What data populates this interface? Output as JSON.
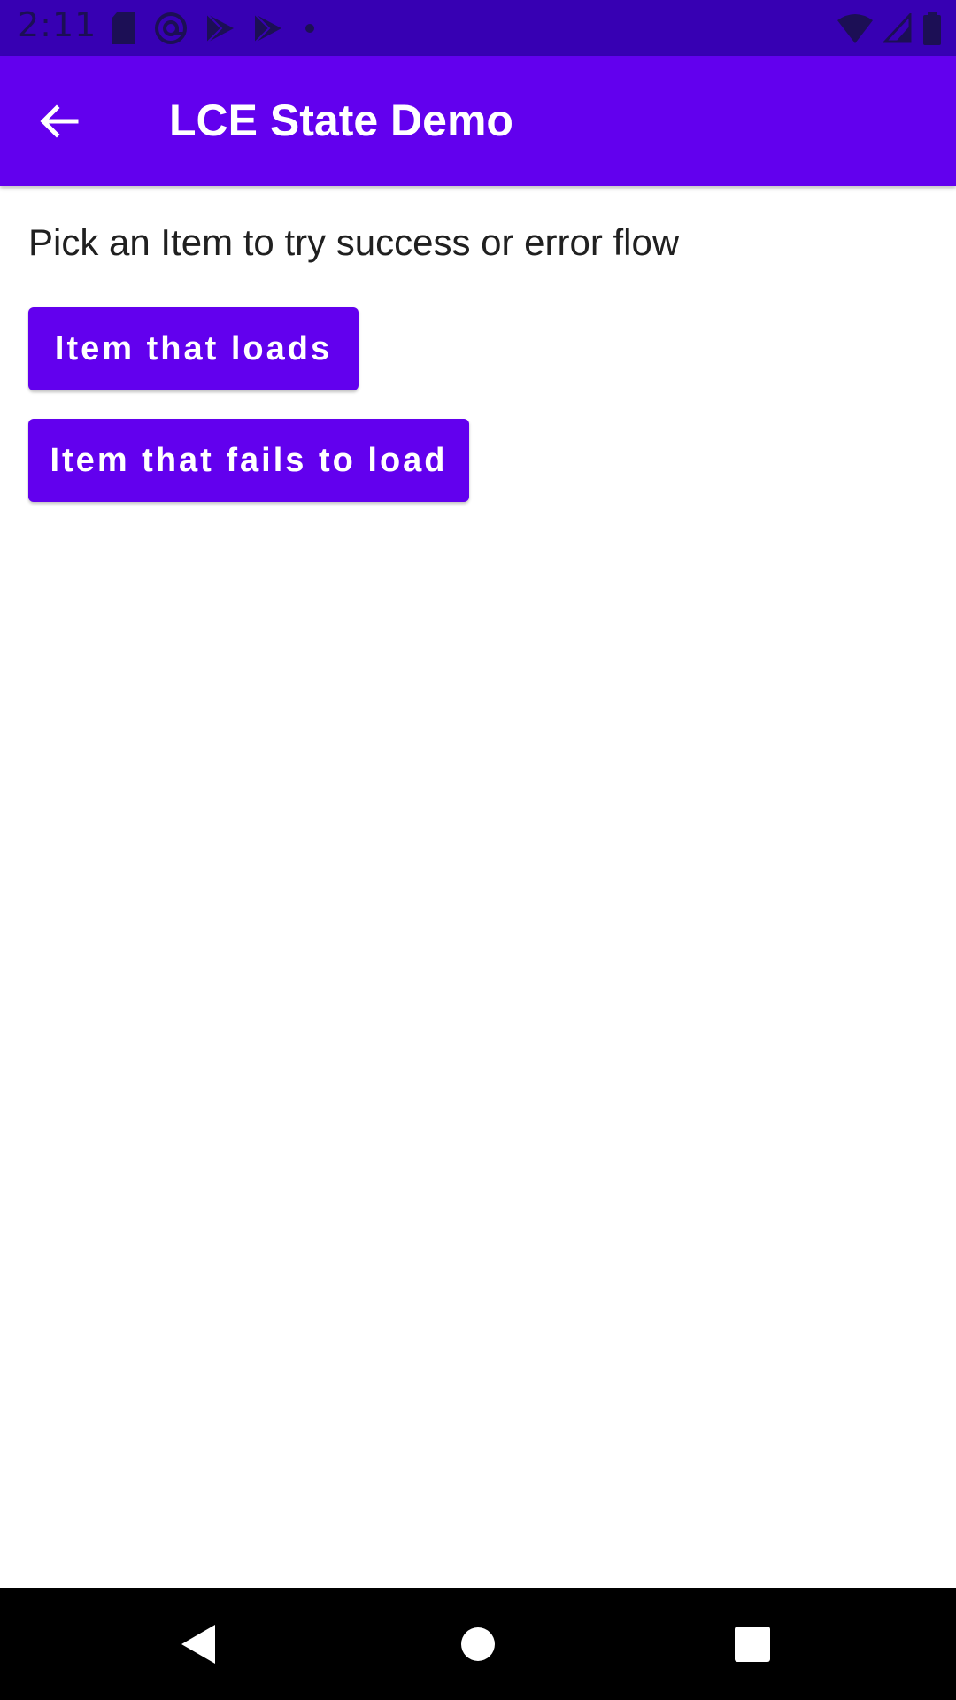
{
  "status_bar": {
    "time": "2:11",
    "background": "#3700b3",
    "left_icons": [
      "sd-card-icon",
      "at-sign-icon",
      "play-store-icon",
      "play-store-icon",
      "dot-icon"
    ],
    "right_icons": [
      "wifi-icon",
      "cell-signal-icon",
      "battery-icon"
    ]
  },
  "app_bar": {
    "title": "LCE State Demo",
    "back_icon": "arrow-back-icon",
    "background": "#6200ee"
  },
  "content": {
    "instruction": "Pick an Item to try success or error flow",
    "buttons": [
      {
        "label": "Item that loads"
      },
      {
        "label": "Item that fails to load"
      }
    ],
    "accent": "#6200ee"
  },
  "nav_bar": {
    "icons": [
      "nav-back-icon",
      "nav-home-icon",
      "nav-recents-icon"
    ]
  }
}
